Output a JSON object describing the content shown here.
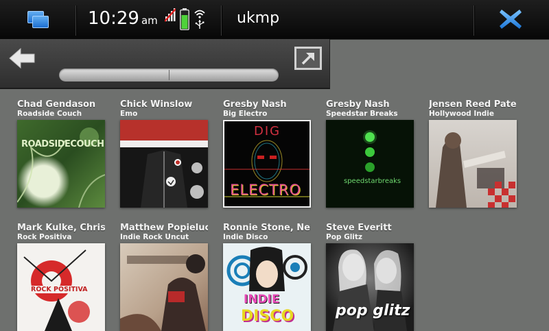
{
  "status_bar": {
    "time": "10:29",
    "ampm": "am",
    "app_title": "ukmp"
  },
  "toolbar": {
    "scroll_position": 0.5
  },
  "albums": [
    {
      "artist": "Chad Gendason",
      "title": "Roadside Couch",
      "cover_text": "ROADSIDECOUCH"
    },
    {
      "artist": "Chick Winslow",
      "title": "Emo"
    },
    {
      "artist": "Gresby Nash",
      "title": "Big Electro",
      "cover_text_top": "DIG",
      "cover_text_bottom": "ELECTRO"
    },
    {
      "artist": "Gresby Nash",
      "title": "Speedstar Breaks",
      "cover_text": "speedstarbreaks"
    },
    {
      "artist": "Jensen Reed Patel",
      "title": "Hollywood Indie"
    },
    {
      "artist": "Mark Kulke, Chris S",
      "title": "Rock Positiva",
      "cover_text": "ROCK POSITIVA"
    },
    {
      "artist": "Matthew Popieluch",
      "title": "Indie Rock Uncut"
    },
    {
      "artist": "Ronnie Stone, Neil",
      "title": "Indie Disco",
      "cover_text_top": "INDIE",
      "cover_text_bottom": "DISCO"
    },
    {
      "artist": "Steve Everitt",
      "title": "Pop Glitz",
      "cover_text": "pop glitz"
    }
  ],
  "colors": {
    "background": "#6e706e",
    "accent_blue": "#2f8de4",
    "battery_green": "#4fd23a"
  },
  "icons": [
    "task-switcher-icon",
    "signal-icon",
    "battery-icon",
    "wifi-icon",
    "usb-icon",
    "close-icon",
    "back-arrow-icon",
    "fullscreen-icon"
  ]
}
